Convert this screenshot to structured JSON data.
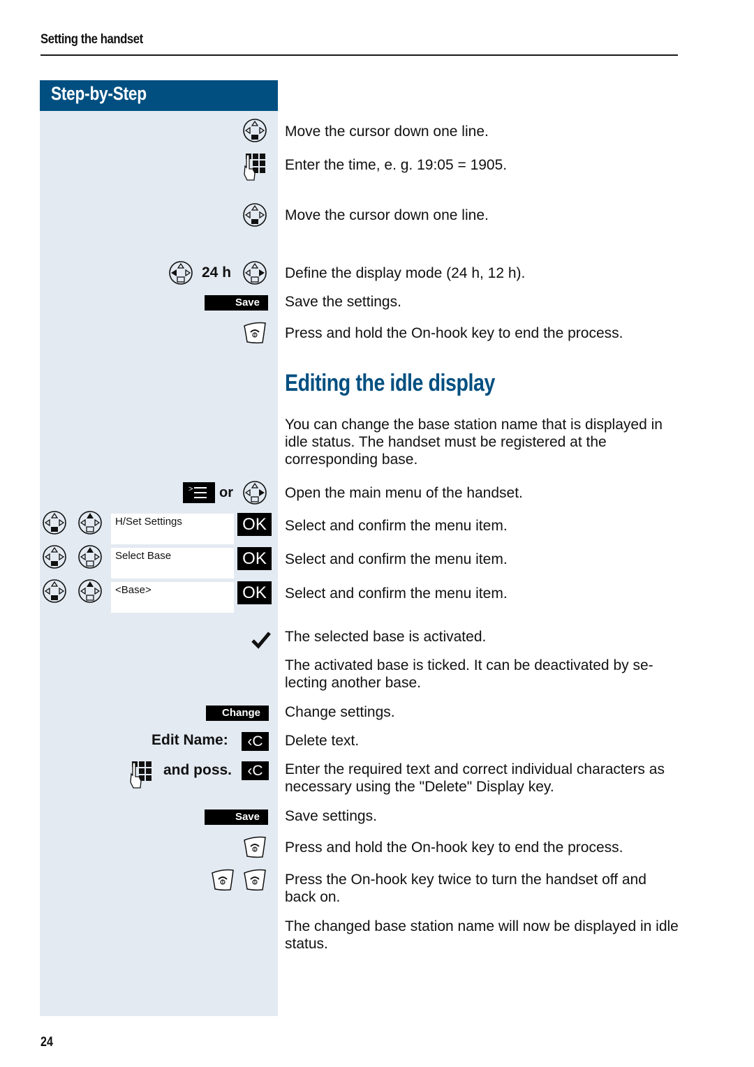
{
  "header": {
    "title": "Setting the handset"
  },
  "step_by_step": {
    "label": "Step-by-Step"
  },
  "section": {
    "title": "Editing the idle display"
  },
  "left_column": {
    "display_mode_value": "24 h",
    "save_key_1": "Save",
    "or_label": "or",
    "menu_items": [
      "H/Set Settings",
      "Select Base",
      "<Base>"
    ],
    "ok_label": "OK",
    "change_key": "Change",
    "edit_name_label": "Edit Name:",
    "and_poss_label": "and poss.",
    "delete_key": "‹C",
    "save_key_2": "Save"
  },
  "steps_before": [
    "Move the cursor down one line.",
    "Enter the time, e. g. 19:05 = 1905.",
    "Move the cursor down one line.",
    "Define the display mode (24 h, 12 h).",
    "Save the settings.",
    "Press and hold the On-hook key to end the process."
  ],
  "intro": "You can change the base station name that is displayed in idle status. The handset must be registered at the corresponding base.",
  "steps": [
    "Open the main menu of the handset.",
    "Select and confirm the menu item.",
    "Select and confirm the menu item.",
    "Select and confirm the menu item.",
    "The selected base is activated.",
    "The activated base is ticked. It can be deactivated by se-lecting another base.",
    "Change settings.",
    "Delete text.",
    "Enter the required text and correct individual characters as necessary using the \"Delete\" Display key.",
    "Save settings.",
    "Press and hold the On-hook key to end the process.",
    "Press the On-hook key twice to turn the handset off and back on.",
    "The changed base station name will now be displayed in idle status."
  ],
  "footer": {
    "page_number": "24"
  },
  "colors": {
    "brand_blue": "#004f80",
    "sidebar_bg": "#e3eaf2"
  }
}
